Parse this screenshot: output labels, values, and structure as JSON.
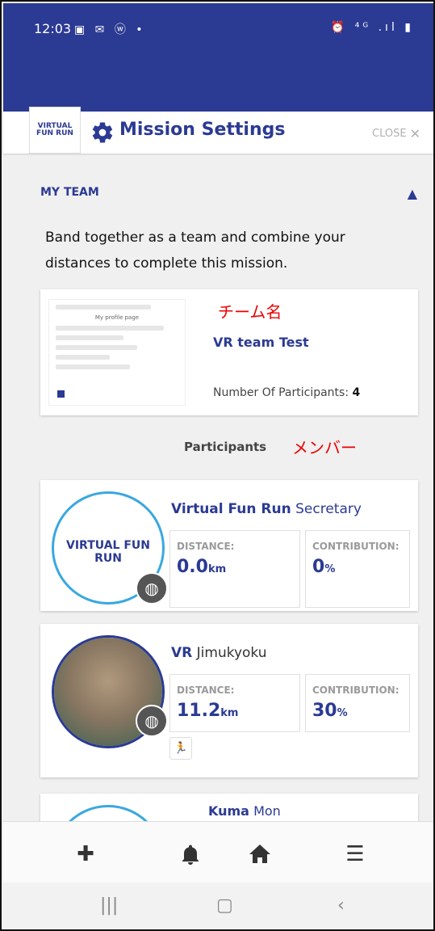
{
  "status_bar": {
    "time": "12:03",
    "left_icons": "▣ ✉ ⓦ •",
    "right_icons": "⏰ ⁴ᴳ .ıl ▮"
  },
  "header": {
    "logo_text": "VIRTUAL FUN RUN",
    "title": "Mission Settings",
    "close_label": "CLOSE"
  },
  "team_section": {
    "label": "MY TEAM",
    "description": "Band together as a team and combine your distances to complete this mission."
  },
  "team_card": {
    "annotation": "チーム名",
    "team_name": "VR team Test",
    "participants_label": "Number Of Participants:",
    "participants_count": "4",
    "thumbnail_title": "My profile page"
  },
  "participants": {
    "heading": "Participants",
    "annotation": "メンバー"
  },
  "members": [
    {
      "name_bold": "Virtual Fun Run",
      "name_tail": " Secretary",
      "distance_label": "DISTANCE:",
      "distance_value": "0.0",
      "distance_unit": "km",
      "contribution_label": "CONTRIBUTION:",
      "contribution_value": "0",
      "contribution_unit": "%",
      "avatar_text": "VIRTUAL FUN RUN"
    },
    {
      "name_bold": "VR",
      "name_tail": " Jimukyoku",
      "distance_label": "DISTANCE:",
      "distance_value": "11.2",
      "distance_unit": "km",
      "contribution_label": "CONTRIBUTION:",
      "contribution_value": "30",
      "contribution_unit": "%"
    },
    {
      "name_bold": "Kuma",
      "name_tail": " Mon"
    }
  ],
  "bottom_nav": [
    "add",
    "notifications",
    "home",
    "menu"
  ],
  "colors": {
    "primary": "#2b3a93",
    "accent_annotation": "#e00000",
    "avatar_ring": "#3aa8e0"
  }
}
